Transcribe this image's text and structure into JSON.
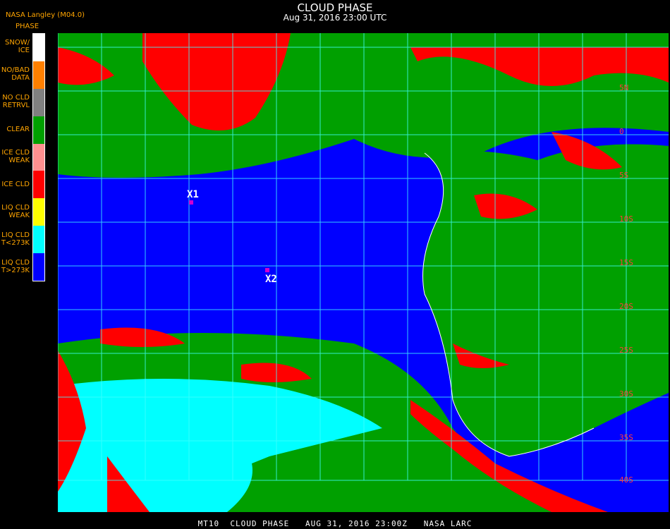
{
  "header": {
    "title": "CLOUD PHASE",
    "subtitle": "Aug 31, 2016 23:00 UTC",
    "source": "NASA Langley (M04.0)",
    "legend_title": "PHASE"
  },
  "legend": [
    {
      "label": "SNOW/\nICE",
      "color": "#ffffff"
    },
    {
      "label": "NO/BAD\nDATA",
      "color": "#ff8000"
    },
    {
      "label": "NO CLD\nRETRVL",
      "color": "#808080"
    },
    {
      "label": "CLEAR",
      "color": "#00a000"
    },
    {
      "label": "ICE CLD\nWEAK",
      "color": "#ff9090"
    },
    {
      "label": "ICE CLD",
      "color": "#ff0000"
    },
    {
      "label": "LIQ CLD\nWEAK",
      "color": "#ffff00"
    },
    {
      "label": "LIQ CLD\nT<273K",
      "color": "#00ffff"
    },
    {
      "label": "LIQ CLD\nT>273K",
      "color": "#0000ff"
    }
  ],
  "lat_labels": [
    "5N",
    "0",
    "5S",
    "10S",
    "15S",
    "20S",
    "25S",
    "30S",
    "35S",
    "40S"
  ],
  "markers": [
    {
      "label": "X1"
    },
    {
      "label": "X2"
    }
  ],
  "footer": "MT10  CLOUD PHASE   AUG 31, 2016 23:00Z   NASA LARC"
}
